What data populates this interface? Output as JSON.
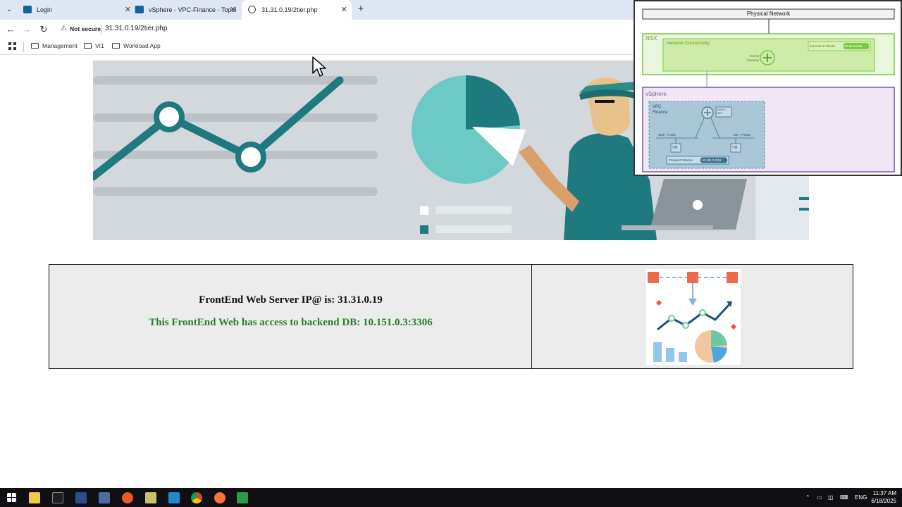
{
  "browser": {
    "tabs": [
      {
        "title": "Login",
        "active": false
      },
      {
        "title": "vSphere - VPC-Finance - Topol",
        "active": false
      },
      {
        "title": "31.31.0.19/2tier.php",
        "active": true
      }
    ],
    "security_label": "Not secure",
    "url": "31.31.0.19/2tier.php",
    "bookmarks": [
      "Management",
      "VI1",
      "Workload App"
    ]
  },
  "page": {
    "frontend_text": "FrontEnd Web Server IP@ is: 31.31.0.19",
    "backend_text": "This FrontEnd Web has access to backend DB: 10.151.0.3:3306",
    "frontend_color": "#111111",
    "backend_color": "#2e7d2e"
  },
  "topology": {
    "physical_network": "Physical Network",
    "nsx": "NSX",
    "network_connectivity": "Network Connectivity",
    "external_ip_label": "External IP Blocks",
    "external_ip_value": "30.30.0.0/16",
    "transit_gateway": "Transit Gateway",
    "vsphere": "vSphere",
    "vpc_label": "VPC",
    "vpc_name": "Finance",
    "dhcp_nat": "DHCP / NAT",
    "web_public": "Web - Public",
    "db_private": "DB - Private",
    "vm": "VM",
    "private_ip_label": "Private IP Blocks",
    "private_ip_value": "10.151.0.0/16"
  },
  "taskbar": {
    "language": "ENG",
    "time": "11:37 AM",
    "date": "6/18/2025"
  },
  "colors": {
    "teal": "#1f7a80",
    "light_teal": "#6cc9c4",
    "nsx_green": "#7ac943",
    "vsphere_purple": "#7b5aa6"
  }
}
